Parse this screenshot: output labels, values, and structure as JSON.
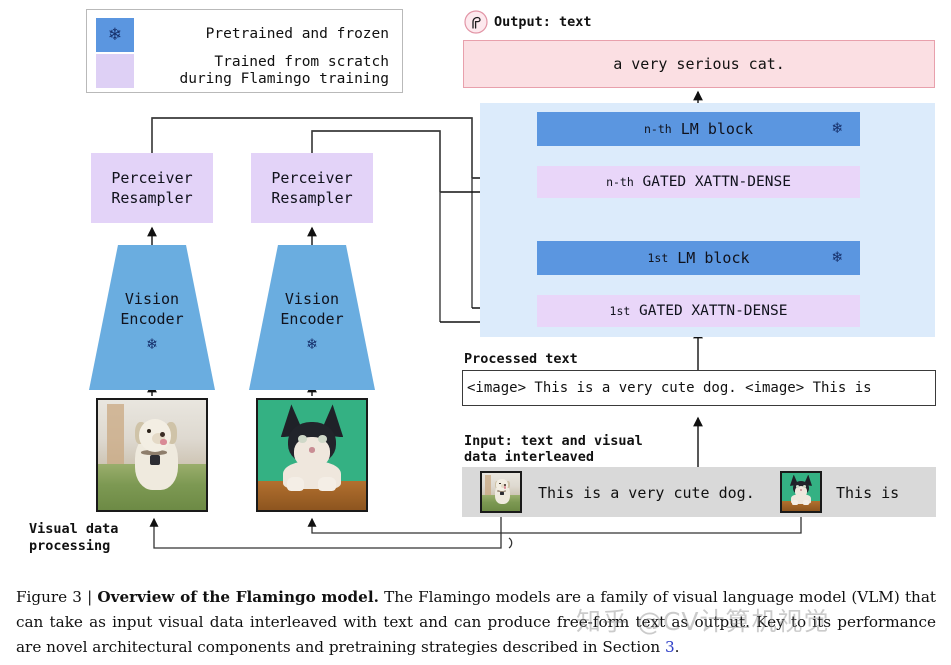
{
  "legend": {
    "frozen": {
      "label": "Pretrained and frozen",
      "icon": "snowflake-icon",
      "color": "#5b96e0"
    },
    "trained": {
      "label": "Trained from scratch\nduring Flamingo training",
      "color": "#ded0f5"
    }
  },
  "vision": {
    "perceiver_label": "Perceiver\nResampler",
    "encoder_label": "Vision\nEncoder",
    "frozen_icon": "❄",
    "processing_label": "Visual data\nprocessing"
  },
  "output": {
    "icon": "flamingo-icon",
    "label": "Output: text",
    "text": "a very serious cat.",
    "box_color": "#fbdfe3",
    "border_color": "#e8a0ac"
  },
  "lm_stack": {
    "panel_color": "#dcebfb",
    "blocks": [
      {
        "name": "lm-block-n",
        "prefix": "n-th",
        "label": "LM block",
        "frozen": true,
        "color": "#5b96e0"
      },
      {
        "name": "xattn-n",
        "prefix": "n-th",
        "label": "GATED XATTN-DENSE",
        "frozen": false,
        "color": "#e9d6f9"
      },
      {
        "name": "lm-block-1",
        "prefix": "1st",
        "label": "LM block",
        "frozen": true,
        "color": "#5b96e0"
      },
      {
        "name": "xattn-1",
        "prefix": "1st",
        "label": "GATED XATTN-DENSE",
        "frozen": false,
        "color": "#e9d6f9"
      }
    ]
  },
  "processed": {
    "label": "Processed text",
    "text": "<image> This is a very cute dog. <image> This is"
  },
  "input": {
    "label": "Input: text and visual\ndata interleaved",
    "text_1": "This is a very cute dog.",
    "text_2": "This is",
    "bar_color": "#d9d9d9"
  },
  "caption": {
    "figure_number": "Figure 3 | ",
    "title": "Overview of the Flamingo model.",
    "body_1": " The Flamingo models are a family of visual language model (VLM) that can take as input visual data interleaved with text and can produce free-form text as output. Key to its performance are novel architectural components and pretraining strategies described in Section ",
    "ref": "3",
    "body_2": "."
  },
  "watermark": {
    "text": "知乎 @CV计算机视觉"
  }
}
